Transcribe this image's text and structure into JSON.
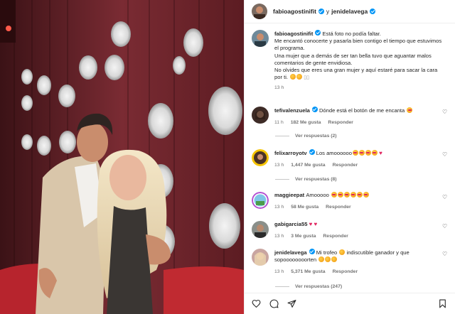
{
  "post": {
    "author": "fabioagostinifit",
    "conjunction": "y",
    "collaborator": "jenidelavega"
  },
  "caption": {
    "username": "fabioagostinifit",
    "text_1": "Está foto no podía faltar.",
    "text_2": "Me encantó conocerte y pasarla bien contigo el tiempo que estuvimos el programa.",
    "text_3": "Una mujer que a demás de ser tan bella tuvo que aguantar malos comentarios de gente envidiosa.",
    "text_4": "No olvides que eres una gran mujer y aquí estaré para sacar la cara por ti.",
    "time": "13 h"
  },
  "comments": [
    {
      "username": "tefivalenzuela",
      "text": "Dónde está el botón de me encanta",
      "time": "11 h",
      "likes": "182 Me gusta",
      "reply": "Responder",
      "replies": "Ver respuestas (2)",
      "emoji": [
        "love"
      ]
    },
    {
      "username": "felixarroyotv",
      "text": "Los amoooooo",
      "time": "13 h",
      "likes": "1,447 Me gusta",
      "reply": "Responder",
      "replies": "Ver respuestas (8)",
      "emoji": [
        "love",
        "love",
        "love",
        "love"
      ],
      "trail": "♥"
    },
    {
      "username": "maggieepat",
      "text": "Amooooo",
      "time": "13 h",
      "likes": "58 Me gusta",
      "reply": "Responder",
      "emoji": [
        "love",
        "love",
        "love",
        "love",
        "love",
        "love"
      ]
    },
    {
      "username": "gabigarcia55",
      "text": "",
      "time": "13 h",
      "likes": "3 Me gusta",
      "reply": "Responder",
      "hearts": "♥ ♥"
    },
    {
      "username": "jenidelavega",
      "text": "Mi trofeo",
      "text_2": "indiscutible ganador y que sopoooooooorten",
      "time": "13 h",
      "likes": "5,371 Me gusta",
      "reply": "Responder",
      "replies": "Ver respuestas (247)"
    }
  ],
  "icons": [
    "heart-icon",
    "comment-icon",
    "share-icon",
    "bookmark-icon"
  ],
  "colors": {
    "verified": "#0095f6",
    "meta": "#737373",
    "heart": "#e0245e"
  }
}
